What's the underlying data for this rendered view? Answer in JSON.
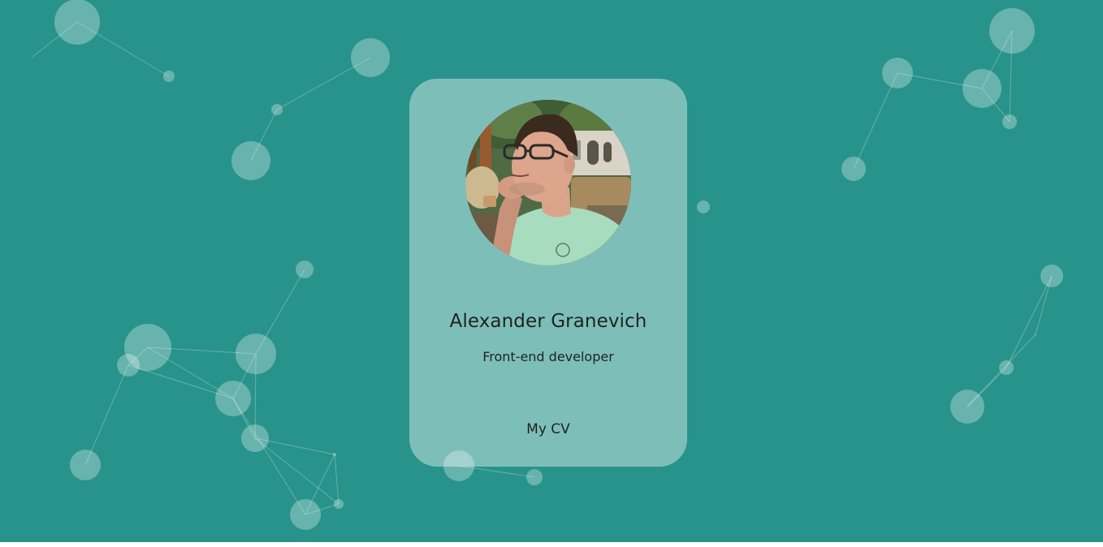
{
  "profile": {
    "name": "Alexander Granevich",
    "role": "Front-end developer",
    "cv_link_label": "My CV",
    "avatar_alt": "Alexander Granevich"
  },
  "colors": {
    "background": "#28938a",
    "card": "rgba(255,255,255,0.40)",
    "text": "#1d2322",
    "particle": "rgba(255,255,255,0.30)"
  },
  "decorations": {
    "background_effect": "connected-particles"
  }
}
